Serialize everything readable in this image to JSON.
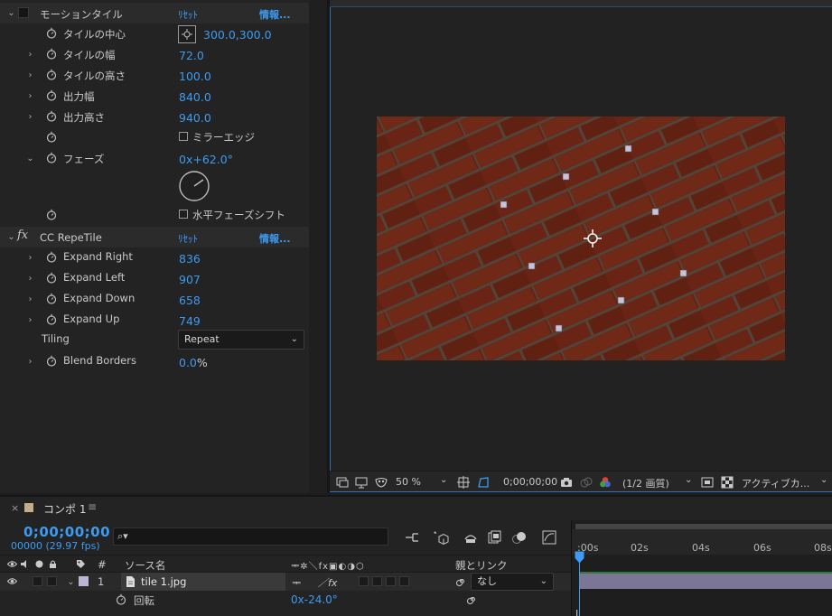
{
  "effects": {
    "motion_tile": {
      "name": "モーションタイル",
      "reset": "ﾘｾｯﾄ",
      "about": "情報...",
      "props": [
        {
          "label": "タイルの中心",
          "value": "300.0,300.0"
        },
        {
          "label": "タイルの幅",
          "value": "72.0"
        },
        {
          "label": "タイルの高さ",
          "value": "100.0"
        },
        {
          "label": "出力幅",
          "value": "840.0"
        },
        {
          "label": "出力高さ",
          "value": "940.0"
        },
        {
          "label": "",
          "value": "ミラーエッジ"
        },
        {
          "label": "フェーズ",
          "value": "0x+62.0°"
        },
        {
          "label": "",
          "value": "水平フェーズシフト"
        }
      ]
    },
    "repetile": {
      "fx": "fx",
      "name": "CC RepeTile",
      "reset": "ﾘｾｯﾄ",
      "about": "情報...",
      "props": [
        {
          "label": "Expand Right",
          "value": "836"
        },
        {
          "label": "Expand Left",
          "value": "907"
        },
        {
          "label": "Expand Down",
          "value": "658"
        },
        {
          "label": "Expand Up",
          "value": "749"
        },
        {
          "label": "Tiling",
          "value": "Repeat"
        },
        {
          "label": "Blend Borders",
          "value": "0.0",
          "unit": "%"
        }
      ]
    }
  },
  "viewer": {
    "zoom": "50 %",
    "timecode": "0;00;00;00",
    "resolution": "(1/2 画質)",
    "camera": "アクティブカ..."
  },
  "timeline": {
    "close": "×",
    "tab": "コンポ 1",
    "menu": "≡",
    "current_time": "0;00;00;00",
    "frames": "00000 (29.97 fps)",
    "search_icon": "⌕▾",
    "columns": {
      "source_name": "ソース名",
      "parent": "親とリンク",
      "hash": "#",
      "switches": "ᆍ✲＼fx▣◐◑⬡"
    },
    "layer": {
      "number": "1",
      "name": "tile 1.jpg",
      "parent": "なし",
      "switch_a": "ᆍ",
      "switch_b": "／fx"
    },
    "sub": {
      "label": "回転",
      "value": "0x-24.0°"
    },
    "ruler": [
      ":00s",
      "02s",
      "04s",
      "06s",
      "08s"
    ],
    "colors": {
      "accent": "#3d9bf2",
      "layer_bar": "#7c7696",
      "label_swatch": "#c6ad8a"
    }
  }
}
